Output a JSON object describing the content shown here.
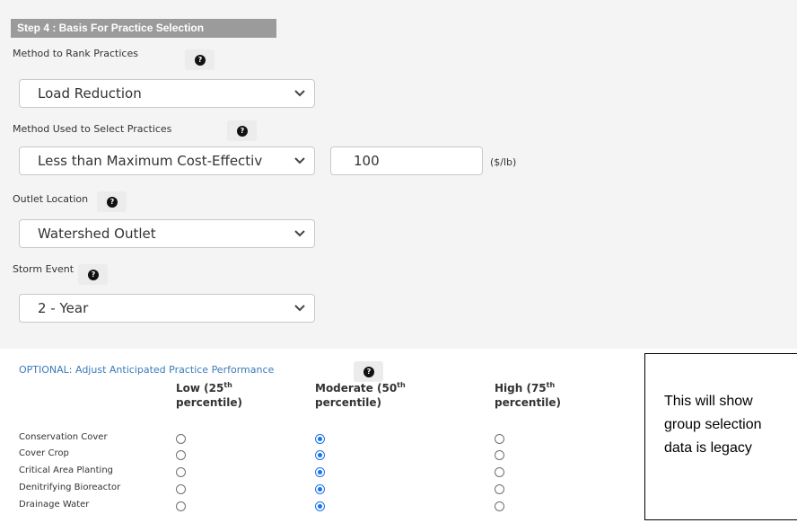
{
  "step_title": "Step 4 : Basis For Practice Selection",
  "fields": {
    "rank": {
      "label": "Method to Rank Practices",
      "value": "Load Reduction"
    },
    "select": {
      "label": "Method Used to Select Practices",
      "value": "Less than Maximum Cost-Effectiv",
      "input_value": "100",
      "unit": "($/lb)"
    },
    "outlet": {
      "label": "Outlet Location",
      "value": "Watershed Outlet"
    },
    "storm": {
      "label": "Storm Event",
      "value": "2 - Year"
    }
  },
  "help_glyph": "?",
  "optional": {
    "title": "OPTIONAL: Adjust Anticipated Practice Performance",
    "columns": [
      {
        "line1": "Low (25",
        "sup": "th",
        "line2": "percentile)"
      },
      {
        "line1": "Moderate (50",
        "sup": "th",
        "line2": "percentile)"
      },
      {
        "line1": "High (75",
        "sup": "th",
        "line2": "percentile)"
      }
    ],
    "rows": [
      {
        "label": "Conservation Cover",
        "selected": "moderate"
      },
      {
        "label": "Cover Crop",
        "selected": "moderate"
      },
      {
        "label": "Critical Area Planting",
        "selected": "moderate"
      },
      {
        "label": "Denitrifying Bioreactor",
        "selected": "moderate"
      },
      {
        "label": "Drainage Water",
        "selected": "moderate"
      }
    ]
  },
  "note_lines": [
    "This will show",
    "group selection",
    "data is legacy"
  ],
  "colors": {
    "accent": "#1a73e8",
    "link": "#3b7bb8",
    "step_bg": "#9b9b9b"
  }
}
